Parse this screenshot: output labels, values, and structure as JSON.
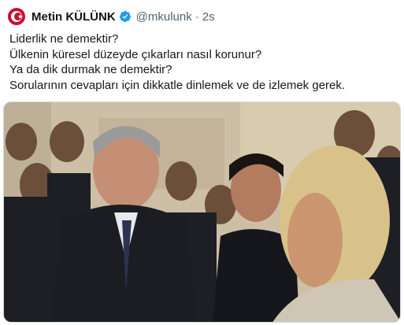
{
  "tweet": {
    "display_name": "Metin KÜLÜNK",
    "handle": "@mkulunk",
    "separator": "·",
    "time": "2s",
    "lines": [
      "Liderlik ne demektir?",
      "Ülkenin küresel düzeyde çıkarları nasıl korunur?",
      "Ya da dik durmak ne demektir?",
      "Sorularının cevapları için dikkatle dinlemek ve de izlemek gerek."
    ]
  },
  "colors": {
    "verified_badge": "#1d9bf0",
    "avatar_background": "#c8102e",
    "muted_text": "#536471"
  },
  "icons": {
    "avatar": "turkish-flag-avatar",
    "verified": "verified-badge-icon"
  }
}
